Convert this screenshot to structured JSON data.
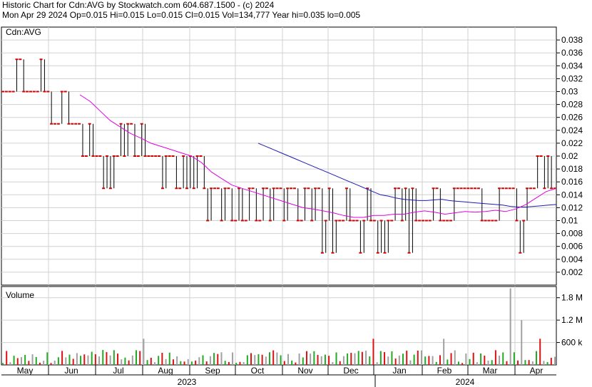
{
  "header": {
    "line1": "Historic Chart for Cdn:AVG by Stockwatch.com 604.687.1500 - (c) 2024",
    "line2": "Mon Apr 29 2024   Op=0.015   Hi=0.015   Lo=0.015   Cl=0.015   Vol=134,777   Year hi=0.035   lo=0.005"
  },
  "chart_data": {
    "type": "line",
    "symbol_label": "Cdn:AVG",
    "volume_label": "Volume",
    "colors": {
      "grid": "#d0d0d0",
      "price_down": "#d40000",
      "price_bar": "#000000",
      "ma_long": "#1c1cb4",
      "ma_short": "#e000e0",
      "vol_up": "#22aa22",
      "vol_down": "#dd1111",
      "vol_flat": "#a0a0a0"
    },
    "price_axis": {
      "min": 0,
      "max": 0.04,
      "ticks": [
        "0.038",
        "0.036",
        "0.034",
        "0.032",
        "0.03",
        "0.028",
        "0.026",
        "0.024",
        "0.022",
        "0.02",
        "0.018",
        "0.016",
        "0.014",
        "0.012",
        "0.01",
        "0.008",
        "0.006",
        "0.004",
        "0.002"
      ]
    },
    "volume_axis": {
      "min": 0,
      "max": 2100000,
      "ticks": [
        "1.8 M",
        "1.2 M",
        "600 k"
      ]
    },
    "months": [
      "May",
      "Jun",
      "Jul",
      "Aug",
      "Sep",
      "Oct",
      "Nov",
      "Dec",
      "Jan",
      "Feb",
      "Mar",
      "Apr"
    ],
    "years": [
      "2023",
      "2024"
    ],
    "price_levels": [
      0.03,
      0.03,
      0.03,
      0.03,
      0.035,
      0.035,
      0.03,
      0.03,
      0.03,
      0.03,
      0.03,
      0.035,
      0.03,
      0.03,
      0.025,
      0.025,
      0.025,
      0.03,
      0.03,
      0.025,
      0.025,
      0.025,
      0.025,
      0.02,
      0.02,
      0.025,
      0.02,
      0.02,
      0.02,
      0.015,
      0.02,
      0.015,
      0.02,
      0.02,
      0.025,
      0.02,
      0.025,
      0.025,
      0.02,
      0.02,
      0.025,
      0.02,
      0.02,
      0.02,
      0.02,
      0.02,
      0.015,
      0.02,
      0.02,
      0.02,
      0.015,
      0.015,
      0.02,
      0.015,
      0.02,
      0.015,
      0.02,
      0.02,
      0.015,
      0.01,
      0.015,
      0.015,
      0.015,
      0.01,
      0.015,
      0.015,
      0.01,
      0.01,
      0.015,
      0.01,
      0.01,
      0.015,
      0.015,
      0.01,
      0.01,
      0.015,
      0.015,
      0.01,
      0.015,
      0.015,
      0.015,
      0.01,
      0.015,
      0.015,
      0.015,
      0.01,
      0.01,
      0.015,
      0.015,
      0.01,
      0.015,
      0.015,
      0.005,
      0.01,
      0.015,
      0.005,
      0.01,
      0.01,
      0.01,
      0.015,
      0.01,
      0.01,
      0.01,
      0.005,
      0.01,
      0.015,
      0.01,
      0.01,
      0.005,
      0.01,
      0.005,
      0.01,
      0.01,
      0.015,
      0.015,
      0.01,
      0.015,
      0.005,
      0.015,
      0.01,
      0.01,
      0.01,
      0.01,
      0.01,
      0.015,
      0.015,
      0.01,
      0.01,
      0.01,
      0.01,
      0.015,
      0.015,
      0.015,
      0.015,
      0.015,
      0.015,
      0.015,
      0.015,
      0.01,
      0.01,
      0.01,
      0.01,
      0.01,
      0.015,
      0.015,
      0.015,
      0.015,
      0.015,
      0.01,
      0.005,
      0.01,
      0.015,
      0.015,
      0.015,
      0.02,
      0.02,
      0.015,
      0.02,
      0.015,
      0.015
    ],
    "ma_long": [
      0.022,
      0.0215,
      0.021,
      0.0205,
      0.02,
      0.0195,
      0.019,
      0.0185,
      0.018,
      0.0175,
      0.017,
      0.0165,
      0.016,
      0.0155,
      0.015,
      0.0145,
      0.014,
      0.0138,
      0.0135,
      0.0133,
      0.0132,
      0.0131,
      0.0131,
      0.0132,
      0.0133,
      0.0131,
      0.013,
      0.0129,
      0.0128,
      0.0127,
      0.0126,
      0.0125,
      0.0124,
      0.0122,
      0.0121,
      0.0121,
      0.0122,
      0.0123,
      0.0124,
      0.0125
    ],
    "ma_short": [
      0.0295,
      0.0285,
      0.027,
      0.0255,
      0.0245,
      0.0235,
      0.0228,
      0.022,
      0.0215,
      0.021,
      0.0205,
      0.02,
      0.019,
      0.0175,
      0.0165,
      0.0155,
      0.015,
      0.0145,
      0.014,
      0.0135,
      0.013,
      0.0125,
      0.012,
      0.0118,
      0.0115,
      0.0112,
      0.0108,
      0.0105,
      0.0105,
      0.0108,
      0.0108,
      0.011,
      0.011,
      0.0113,
      0.0115,
      0.0113,
      0.011,
      0.0112,
      0.0114,
      0.0113,
      0.0114,
      0.0116,
      0.0114,
      0.0118,
      0.0125,
      0.0135,
      0.0145,
      0.015
    ]
  }
}
